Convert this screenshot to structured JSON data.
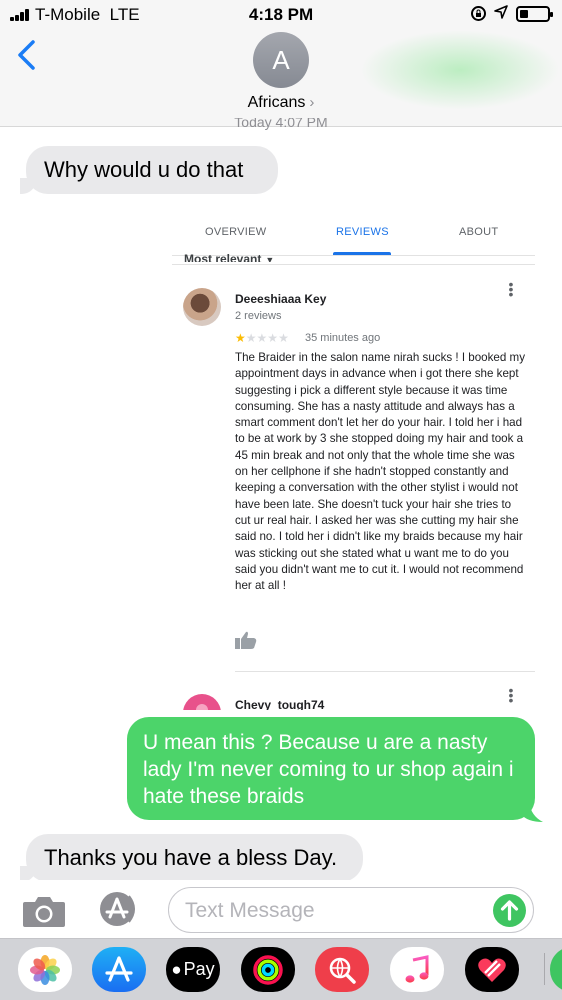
{
  "status_bar": {
    "carrier": "T-Mobile",
    "network": "LTE",
    "time": "4:18 PM",
    "signal_bars": 4,
    "battery_level": 0.3
  },
  "header": {
    "avatar_initial": "A",
    "contact_name": "Africans",
    "partial_timestamp": "Today 4:07 PM"
  },
  "messages": [
    {
      "direction": "incoming",
      "text": "Why would u do that"
    },
    {
      "direction": "outgoing",
      "text": "U mean this ? Because u are a nasty lady I'm never coming to ur shop again i hate these braids"
    },
    {
      "direction": "incoming",
      "text": "Thanks you have a bless Day."
    }
  ],
  "attached_screenshot": {
    "tabs": [
      {
        "label": "OVERVIEW",
        "active": false
      },
      {
        "label": "REVIEWS",
        "active": true
      },
      {
        "label": "ABOUT",
        "active": false
      }
    ],
    "sort_label": "Most relevant",
    "reviews": [
      {
        "author": "Deeeshiaaa Key",
        "review_count": "2 reviews",
        "rating": 1,
        "max_rating": 5,
        "time": "35 minutes ago",
        "text": "The Braider in the salon name nirah sucks ! I booked my appointment days in advance when i got there she kept suggesting i pick a different style because it was time consuming.  She has a nasty attitude and always has a smart comment don't let her do your hair. I told her i had to be at work by 3 she stopped doing my hair and took a 45 min break and not only that the whole time she was on her cellphone if she hadn't stopped constantly and keeping a conversation with the other stylist i would not have been late. She doesn't tuck your hair she tries to cut ur real hair. I asked her was she cutting my hair she said no. I told her i didn't like my braids because my hair was sticking out she stated what u want me to do you said you didn't want me to cut it. I would not recommend her at all !"
      },
      {
        "author": "Chevy_tough74"
      }
    ]
  },
  "input": {
    "placeholder": "Text Message",
    "value": ""
  },
  "app_tray": {
    "apps": [
      {
        "name": "photos-app",
        "label": ""
      },
      {
        "name": "app-store-app",
        "label": ""
      },
      {
        "name": "apple-pay-app",
        "label": "Pay"
      },
      {
        "name": "activity-app",
        "label": ""
      },
      {
        "name": "search-images-app",
        "label": ""
      },
      {
        "name": "music-app",
        "label": ""
      },
      {
        "name": "heart-app",
        "label": ""
      }
    ]
  },
  "colors": {
    "outgoing_bubble": "#4cd46a",
    "incoming_bubble": "#e9e9eb",
    "ios_blue": "#1a7cf5",
    "maps_blue": "#1a73e8",
    "star_gold": "#fbbc04",
    "send_green": "#3fc561"
  }
}
